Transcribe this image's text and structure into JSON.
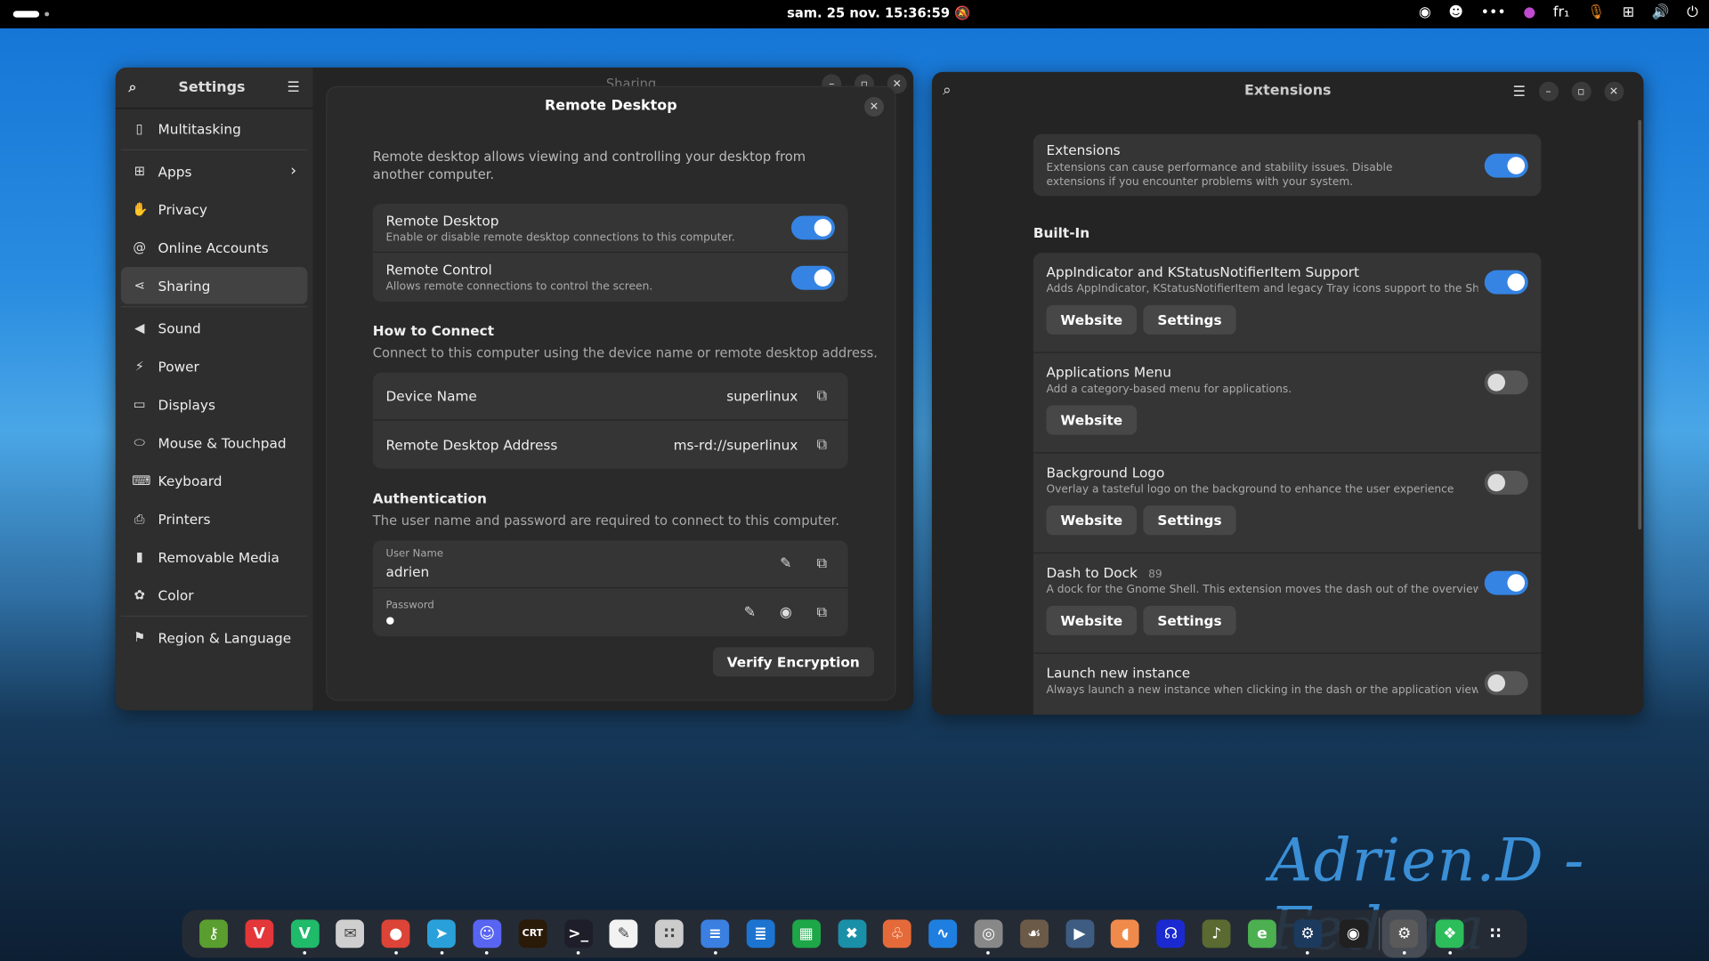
{
  "topbar": {
    "clock": "sam. 25 nov.  15:36:59",
    "keyboard": "fr₁",
    "icons": [
      "steam-icon",
      "discord-icon",
      "more-icon",
      "firefox-icon",
      "keyboard-icon",
      "microphone-icon",
      "network-icon",
      "volume-icon",
      "power-icon"
    ]
  },
  "settings": {
    "title": "Settings",
    "page_title": "Sharing",
    "sidebar": [
      {
        "label": "Multitasking",
        "icon": "multitasking-icon"
      },
      {
        "label": "Apps",
        "icon": "apps-icon",
        "chevron": true
      },
      {
        "label": "Privacy",
        "icon": "hand-icon"
      },
      {
        "label": "Online Accounts",
        "icon": "at-icon"
      },
      {
        "label": "Sharing",
        "icon": "share-icon",
        "active": true
      },
      {
        "label": "Sound",
        "icon": "sound-icon"
      },
      {
        "label": "Power",
        "icon": "power-icon"
      },
      {
        "label": "Displays",
        "icon": "display-icon"
      },
      {
        "label": "Mouse & Touchpad",
        "icon": "mouse-icon"
      },
      {
        "label": "Keyboard",
        "icon": "keyboard-icon"
      },
      {
        "label": "Printers",
        "icon": "printer-icon"
      },
      {
        "label": "Removable Media",
        "icon": "usb-icon"
      },
      {
        "label": "Color",
        "icon": "color-icon"
      },
      {
        "label": "Region & Language",
        "icon": "flag-icon"
      }
    ]
  },
  "remote": {
    "title": "Remote Desktop",
    "intro": "Remote desktop allows viewing and controlling your desktop from another computer.",
    "toggles": [
      {
        "title": "Remote Desktop",
        "sub": "Enable or disable remote desktop connections to this computer.",
        "on": true
      },
      {
        "title": "Remote Control",
        "sub": "Allows remote connections to control the screen.",
        "on": true
      }
    ],
    "connect_heading": "How to Connect",
    "connect_sub": "Connect to this computer using the device name or remote desktop address.",
    "device_label": "Device Name",
    "device_value": "superlinux",
    "address_label": "Remote Desktop Address",
    "address_value": "ms-rd://superlinux",
    "auth_heading": "Authentication",
    "auth_sub": "The user name and password are required to connect to this computer.",
    "user_label": "User Name",
    "user_value": "adrien",
    "pass_label": "Password",
    "pass_value": "●",
    "verify": "Verify Encryption"
  },
  "extensions": {
    "title": "Extensions",
    "master": {
      "title": "Extensions",
      "sub": "Extensions can cause performance and stability issues. Disable extensions if you encounter problems with your system.",
      "on": true
    },
    "builtin_heading": "Built-In",
    "items": [
      {
        "name": "AppIndicator and KStatusNotifierItem Support",
        "version": "",
        "desc": "Adds AppIndicator, KStatusNotifierItem and legacy Tray icons support to the Shell",
        "on": true,
        "buttons": [
          "Website",
          "Settings"
        ]
      },
      {
        "name": "Applications Menu",
        "version": "",
        "desc": "Add a category-based menu for applications.",
        "on": false,
        "buttons": [
          "Website"
        ]
      },
      {
        "name": "Background Logo",
        "version": "",
        "desc": "Overlay a tasteful logo on the background to enhance the user experience",
        "on": false,
        "buttons": [
          "Website",
          "Settings"
        ]
      },
      {
        "name": "Dash to Dock",
        "version": "89",
        "desc": "A dock for the Gnome Shell. This extension moves the dash out of the overview transfor…",
        "on": true,
        "buttons": [
          "Website",
          "Settings"
        ]
      },
      {
        "name": "Launch new instance",
        "version": "",
        "desc": "Always launch a new instance when clicking in the dash or the application view.",
        "on": false,
        "buttons": []
      }
    ]
  },
  "signature": "Adrien.D - Fedora",
  "dock": [
    {
      "icon": "keepassxc-icon",
      "color": "#5a9e2f",
      "glyph": "⚷"
    },
    {
      "icon": "vivaldi-red-icon",
      "color": "#e3373a",
      "glyph": "V"
    },
    {
      "icon": "vivaldi-icon",
      "color": "#1fba6a",
      "glyph": "V",
      "running": true
    },
    {
      "icon": "mail-scheduler-icon",
      "color": "#cfcfcf",
      "glyph": "✉"
    },
    {
      "icon": "chrome-icon",
      "color": "#db4437",
      "glyph": "●",
      "running": true
    },
    {
      "icon": "telegram-icon",
      "color": "#2aa0da",
      "glyph": "➤",
      "running": true
    },
    {
      "icon": "discord-icon",
      "color": "#5865f2",
      "glyph": "☺",
      "running": true
    },
    {
      "icon": "cool-retro-term-icon",
      "color": "#2a1a08",
      "glyph": "CRT"
    },
    {
      "icon": "terminal-icon",
      "color": "#1e1e2a",
      "glyph": ">_",
      "running": true
    },
    {
      "icon": "text-editor-icon",
      "color": "#f2f2f2",
      "glyph": "✎"
    },
    {
      "icon": "calculator-icon",
      "color": "#cccccc",
      "glyph": "∷"
    },
    {
      "icon": "file-cabinet-icon",
      "color": "#3b7fe0",
      "glyph": "≡",
      "running": true
    },
    {
      "icon": "writer-icon",
      "color": "#1c74d0",
      "glyph": "≣"
    },
    {
      "icon": "spreadsheet-icon",
      "color": "#1ea748",
      "glyph": "▦"
    },
    {
      "icon": "xbox-icon",
      "color": "#1a8fa8",
      "glyph": "✖"
    },
    {
      "icon": "bottles-icon",
      "color": "#e56a3a",
      "glyph": "♧"
    },
    {
      "icon": "system-monitor-icon",
      "color": "#1f7fe0",
      "glyph": "∿"
    },
    {
      "icon": "disc-icon",
      "color": "#888888",
      "glyph": "◎",
      "running": true
    },
    {
      "icon": "gimp-icon",
      "color": "#6b5a48",
      "glyph": "☙"
    },
    {
      "icon": "app-icon",
      "color": "#3e5c82",
      "glyph": "▶"
    },
    {
      "icon": "clementine-icon",
      "color": "#f08a4b",
      "glyph": "◖"
    },
    {
      "icon": "audacity-icon",
      "color": "#1a2ad0",
      "glyph": "☊"
    },
    {
      "icon": "music-icon",
      "color": "#5a6a30",
      "glyph": "♪"
    },
    {
      "icon": "ebook-icon",
      "color": "#4caf50",
      "glyph": "e"
    },
    {
      "icon": "steam-icon",
      "color": "#1b3a5e",
      "glyph": "⚙",
      "running": true
    },
    {
      "icon": "obs-icon",
      "color": "#202020",
      "glyph": "◉"
    },
    {
      "icon": "settings-icon",
      "color": "#5a5a5a",
      "glyph": "⚙",
      "running": true,
      "selected": true
    },
    {
      "icon": "extensions-icon",
      "color": "#2dbd5a",
      "glyph": "❖",
      "running": true
    },
    {
      "icon": "app-grid-icon",
      "color": "transparent",
      "glyph": "∷"
    }
  ]
}
